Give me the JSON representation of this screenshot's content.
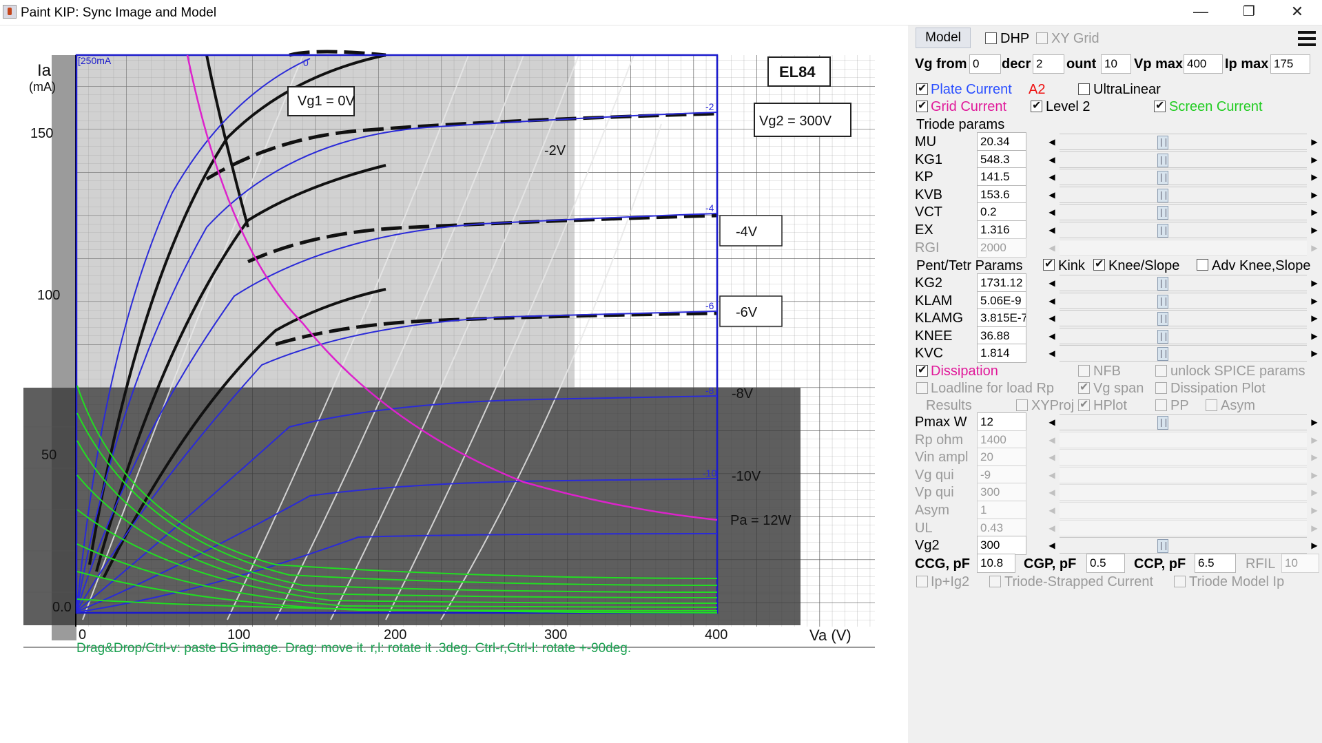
{
  "window": {
    "title": "Paint KIP: Sync Image and Model",
    "minimize_glyph": "—",
    "maximize_glyph": "❐",
    "close_glyph": "✕"
  },
  "plot": {
    "tube_label": "EL84",
    "vg2_label": "Vg2 = 300V",
    "vg1_label": "Vg1 = 0V",
    "ia_label": "Ia",
    "ia_unit": "(mA)",
    "va_label": "Va (V)",
    "corner_label": "[250mA",
    "curve_labels": [
      "-2V",
      "-4V",
      "-6V",
      "-8V",
      "-10V",
      "Pa = 12W"
    ],
    "model_curve_tags": [
      "0",
      "-2",
      "-4",
      "-6",
      "-8",
      "-10"
    ],
    "y_ticks": [
      "150",
      "100",
      "50",
      "0.0"
    ],
    "x_ticks": [
      "0",
      "100",
      "200",
      "300",
      "400"
    ],
    "hint": "Drag&Drop/Ctrl-v: paste BG image. Drag: move it. r,l: rotate it .3deg. Ctrl-r,Ctrl-l: rotate +-90deg.",
    "colors": {
      "model": "#2222cc",
      "grid_current": "#22dd22",
      "dissipation": "#dd22cc",
      "frame": "#1a1acc"
    }
  },
  "panel": {
    "model_button": "Model",
    "dhp_label": "DHP",
    "xygrid_label": "XY Grid",
    "vg_from_label": "Vg from",
    "vg_from_value": "0",
    "decr_label": "decr",
    "decr_value": "2",
    "count_label": "ount",
    "count_value": "10",
    "vpmax_label": "Vp max",
    "vpmax_value": "400",
    "ipmax_label": "Ip max",
    "ipmax_value": "175",
    "plate_current": "Plate Current",
    "a2": "A2",
    "ultralinear": "UltraLinear",
    "grid_current": "Grid Current",
    "level2": "Level 2",
    "screen_current": "Screen Current",
    "triode_params": "Triode params",
    "params1": [
      {
        "label": "MU",
        "value": "20.34",
        "enabled": true
      },
      {
        "label": "KG1",
        "value": "548.3",
        "enabled": true
      },
      {
        "label": "KP",
        "value": "141.5",
        "enabled": true
      },
      {
        "label": "KVB",
        "value": "153.6",
        "enabled": true
      },
      {
        "label": "VCT",
        "value": "0.2",
        "enabled": true
      },
      {
        "label": "EX",
        "value": "1.316",
        "enabled": true
      },
      {
        "label": "RGI",
        "value": "2000",
        "enabled": false
      }
    ],
    "pent_label": "Pent/Tetr Params",
    "kink": "Kink",
    "knee_slope": "Knee/Slope",
    "adv_knee": "Adv Knee,Slope",
    "params2": [
      {
        "label": "KG2",
        "value": "1731.12",
        "enabled": true
      },
      {
        "label": "KLAM",
        "value": "5.06E-9",
        "enabled": true
      },
      {
        "label": "KLAMG",
        "value": "3.815E-7",
        "enabled": true
      },
      {
        "label": "KNEE",
        "value": "36.88",
        "enabled": true
      },
      {
        "label": "KVC",
        "value": "1.814",
        "enabled": true
      }
    ],
    "dissipation": "Dissipation",
    "nfb": "NFB",
    "unlock": "unlock SPICE params",
    "loadline": "Loadline for load Rp",
    "vgspan": "Vg span",
    "dissplot": "Dissipation Plot",
    "results": "Results",
    "xyproj": "XYProj",
    "hplot": "HPlot",
    "pp": "PP",
    "asym_cb": "Asym",
    "params3": [
      {
        "label": "Pmax W",
        "value": "12",
        "enabled": true
      },
      {
        "label": "Rp ohm",
        "value": "1400",
        "enabled": false
      },
      {
        "label": "Vin ampl",
        "value": "20",
        "enabled": false
      },
      {
        "label": "Vg qui",
        "value": "-9",
        "enabled": false
      },
      {
        "label": "Vp qui",
        "value": "300",
        "enabled": false
      },
      {
        "label": "Asym",
        "value": "1",
        "enabled": false
      },
      {
        "label": "UL",
        "value": "0.43",
        "enabled": false
      },
      {
        "label": "Vg2",
        "value": "300",
        "enabled": true
      }
    ],
    "ccg_label": "CCG, pF",
    "ccg_value": "10.8",
    "cgp_label": "CGP, pF",
    "cgp_value": "0.5",
    "ccp_label": "CCP, pF",
    "ccp_value": "6.5",
    "rfil_label": "RFIL",
    "rfil_value": "10",
    "ipig2": "Ip+Ig2",
    "triode_strapped": "Triode-Strapped Current",
    "triode_model_ip": "Triode Model Ip"
  }
}
